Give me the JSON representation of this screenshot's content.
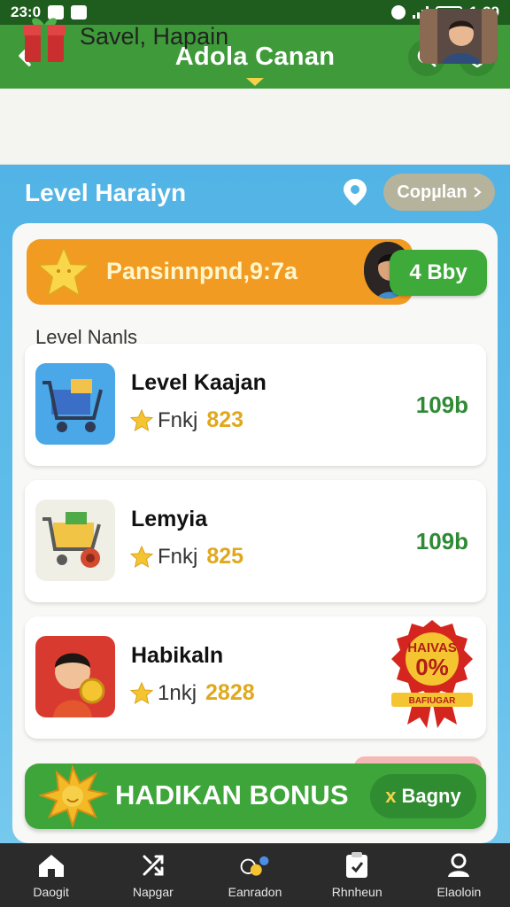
{
  "status_bar": {
    "time_left": "23:0",
    "time_right": "1:39"
  },
  "app_bar": {
    "title": "Adola Canan",
    "back_icon": "arrow-left-icon",
    "search_icon": "search-icon",
    "shield_icon": "shield-icon"
  },
  "header": {
    "title": "Savel, Hapain",
    "gift_icon": "gift-icon"
  },
  "level": {
    "title": "Level Haraiyn",
    "pin_icon": "location-pin-icon",
    "button_label": "Copµlan"
  },
  "promo": {
    "text": "Pansinnpnd,9:7a",
    "pill_label": "4 Bby"
  },
  "section_label": "Level Nanls",
  "items": [
    {
      "title": "Level Kaajan",
      "label": "Fnkj",
      "value": "823",
      "right": "109b"
    },
    {
      "title": "Lemyia",
      "label": "Fnkj",
      "value": "825",
      "right": "109b"
    },
    {
      "title": "Habikaln",
      "label": "1nkj",
      "value": "2828",
      "badge_top": "HAIVAS",
      "badge_mid": "0%",
      "badge_bottom": "BAFIUGAR"
    }
  ],
  "bonus": {
    "text": "HADIKAN BONUS",
    "pill_label": "Bagny",
    "pill_icon": "x"
  },
  "bottom_nav": [
    {
      "label": "Daogit",
      "icon": "home-icon"
    },
    {
      "label": "Napgar",
      "icon": "swap-icon"
    },
    {
      "label": "Eanradon",
      "icon": "coins-icon"
    },
    {
      "label": "Rhnheun",
      "icon": "clipboard-icon"
    },
    {
      "label": "Elaoloin",
      "icon": "user-icon"
    }
  ],
  "colors": {
    "app_green": "#3f9a3a",
    "sky": "#52b3e6",
    "orange": "#f29b22",
    "gold": "#e0a81c"
  }
}
